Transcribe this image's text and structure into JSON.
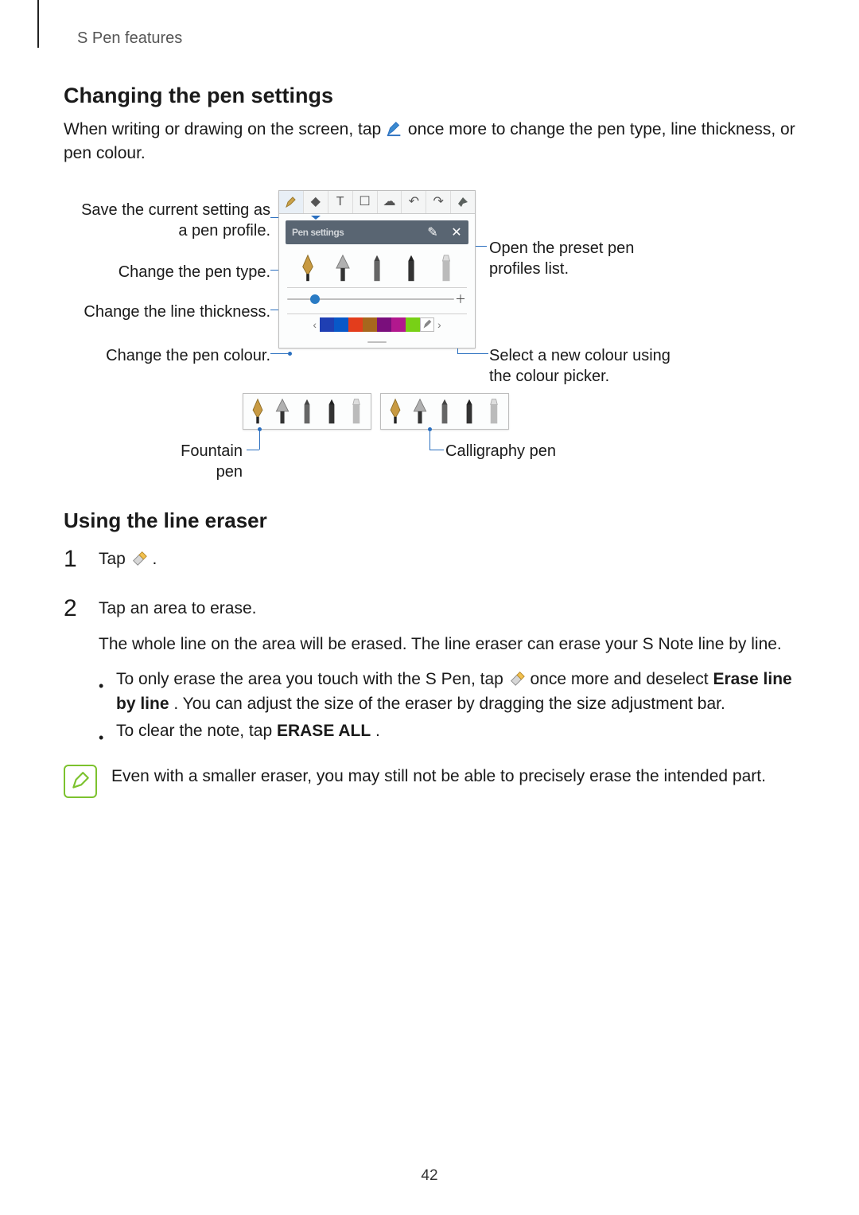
{
  "header": {
    "section": "S Pen features"
  },
  "pageNumber": "42",
  "sec1": {
    "title": "Changing the pen settings",
    "intro_a": "When writing or drawing on the screen, tap ",
    "intro_b": " once more to change the pen type, line thickness, or pen colour."
  },
  "panel": {
    "profile_label": "Pen settings",
    "swatches": [
      "#1f3fb3",
      "#0858c8",
      "#e33d1c",
      "#a7671d",
      "#7a0f7c",
      "#b2188e",
      "#78d016",
      "#d8d8d8"
    ]
  },
  "callouts": {
    "save_profile": "Save the current setting as a pen profile.",
    "change_type": "Change the pen type.",
    "change_thickness": "Change the line thickness.",
    "change_colour": "Change the pen colour.",
    "open_presets": "Open the preset pen profiles list.",
    "colour_picker": "Select a new colour using the colour picker.",
    "fountain": "Fountain pen",
    "calligraphy": "Calligraphy pen"
  },
  "sec2": {
    "title": "Using the line eraser",
    "step1": "Tap ",
    "step1_suffix": ".",
    "step2_line1": "Tap an area to erase.",
    "step2_line2": "The whole line on the area will be erased. The line eraser can erase your S Note line by line.",
    "bullet1_a": "To only erase the area you touch with the S Pen, tap ",
    "bullet1_b": " once more and deselect ",
    "bullet1_bold": "Erase line by line",
    "bullet1_c": ". You can adjust the size of the eraser by dragging the size adjustment bar.",
    "bullet2_a": "To clear the note, tap ",
    "bullet2_bold": "ERASE ALL",
    "bullet2_b": ".",
    "note": "Even with a smaller eraser, you may still not be able to precisely erase the intended part."
  }
}
